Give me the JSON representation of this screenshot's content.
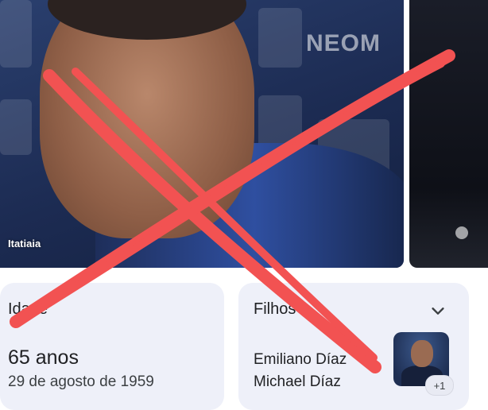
{
  "photo": {
    "credit": "Itatiaia",
    "sponsor_text": "NEOM"
  },
  "age_card": {
    "label": "Idade",
    "value": "65 anos",
    "dob": "29 de agosto de 1959"
  },
  "children_card": {
    "label": "Filhos",
    "names": [
      "Emiliano Díaz",
      "Michael Díaz"
    ],
    "more_badge": "+1",
    "expand_icon": "chevron-down-icon"
  },
  "overlay": {
    "mark": "red-x",
    "color": "#f25252"
  }
}
